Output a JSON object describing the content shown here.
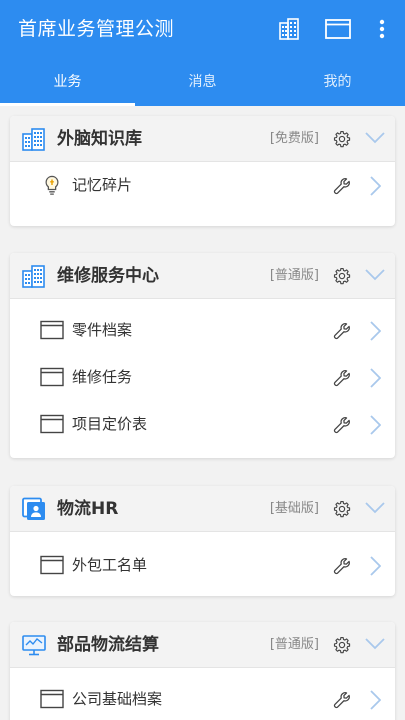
{
  "app": {
    "title": "首席业务管理公测",
    "actions": [
      "building-icon",
      "window-icon",
      "more-vert-icon"
    ]
  },
  "tabs": [
    {
      "label": "业务",
      "active": true
    },
    {
      "label": "消息",
      "active": false
    },
    {
      "label": "我的",
      "active": false
    }
  ],
  "colors": {
    "primary": "#2d8cf0",
    "icon_blue": "#2d8cf0",
    "chevron": "#a9c8ec"
  },
  "cards": [
    {
      "title": "外脑知识库",
      "edition": "[免费版]",
      "icon": "building-icon",
      "rows": [
        {
          "label": "记忆碎片",
          "icon": "lightbulb-icon"
        }
      ]
    },
    {
      "title": "维修服务中心",
      "edition": "[普通版]",
      "icon": "building-icon",
      "rows": [
        {
          "label": "零件档案",
          "icon": "window-icon"
        },
        {
          "label": "维修任务",
          "icon": "window-icon"
        },
        {
          "label": "项目定价表",
          "icon": "window-icon"
        }
      ]
    },
    {
      "title": "物流HR",
      "edition": "[基础版]",
      "icon": "id-card-icon",
      "rows": [
        {
          "label": "外包工名单",
          "icon": "window-icon"
        }
      ]
    },
    {
      "title": "部品物流结算",
      "edition": "[普通版]",
      "icon": "monitor-icon",
      "rows": [
        {
          "label": "公司基础档案",
          "icon": "window-icon"
        }
      ]
    }
  ]
}
